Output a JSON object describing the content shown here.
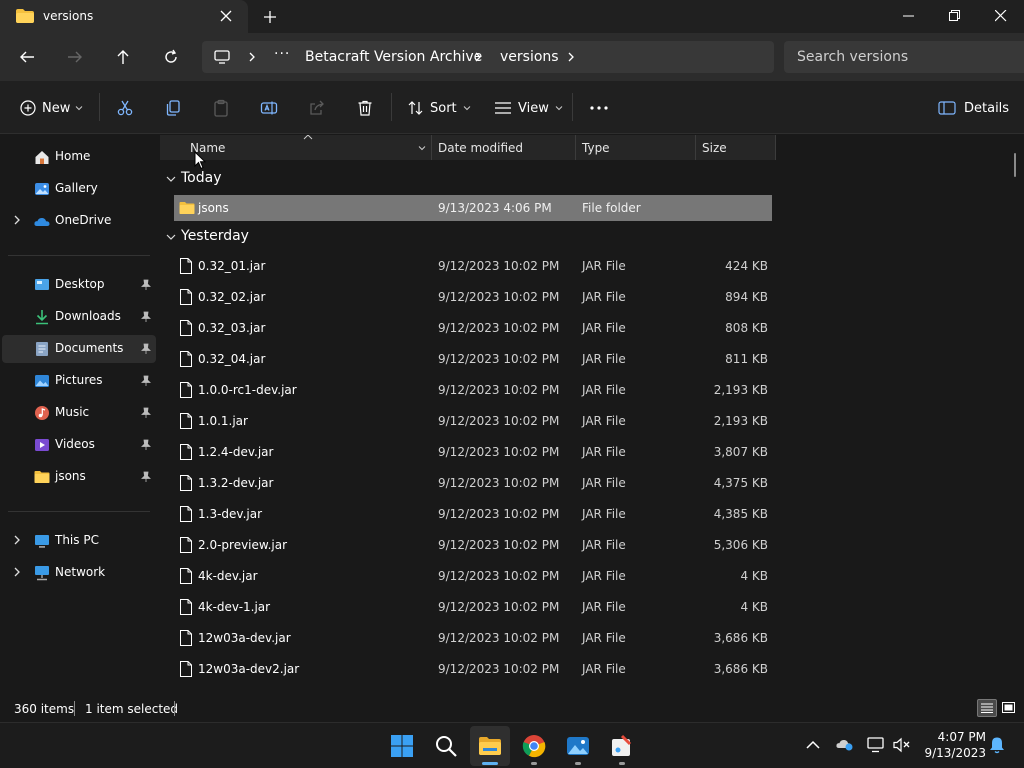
{
  "titlebar": {
    "tab_title": "versions",
    "colors": {
      "folder": "#f4c03e"
    }
  },
  "address": {
    "crumbs": [
      "Betacraft Version Archive",
      "versions"
    ],
    "search_placeholder": "Search versions"
  },
  "commands": {
    "new": "New",
    "sort": "Sort",
    "view": "View",
    "details": "Details"
  },
  "sidebar": {
    "items": [
      {
        "label": "Home",
        "icon": "home-icon"
      },
      {
        "label": "Gallery",
        "icon": "gallery-icon"
      },
      {
        "label": "OneDrive",
        "icon": "onedrive-icon"
      },
      {
        "label": "Desktop",
        "icon": "desktop-icon"
      },
      {
        "label": "Downloads",
        "icon": "download-icon"
      },
      {
        "label": "Documents",
        "icon": "documents-icon"
      },
      {
        "label": "Pictures",
        "icon": "pictures-icon"
      },
      {
        "label": "Music",
        "icon": "music-icon"
      },
      {
        "label": "Videos",
        "icon": "videos-icon"
      },
      {
        "label": "jsons",
        "icon": "folder-icon"
      },
      {
        "label": "This PC",
        "icon": "pc-icon"
      },
      {
        "label": "Network",
        "icon": "network-icon"
      }
    ]
  },
  "columns": {
    "name": "Name",
    "date": "Date modified",
    "type": "Type",
    "size": "Size"
  },
  "groups": {
    "today": "Today",
    "yesterday": "Yesterday"
  },
  "files": [
    {
      "name": "jsons",
      "date": "9/13/2023 4:06 PM",
      "type": "File folder",
      "size": ""
    },
    {
      "name": "0.32_01.jar",
      "date": "9/12/2023 10:02 PM",
      "type": "JAR File",
      "size": "424 KB"
    },
    {
      "name": "0.32_02.jar",
      "date": "9/12/2023 10:02 PM",
      "type": "JAR File",
      "size": "894 KB"
    },
    {
      "name": "0.32_03.jar",
      "date": "9/12/2023 10:02 PM",
      "type": "JAR File",
      "size": "808 KB"
    },
    {
      "name": "0.32_04.jar",
      "date": "9/12/2023 10:02 PM",
      "type": "JAR File",
      "size": "811 KB"
    },
    {
      "name": "1.0.0-rc1-dev.jar",
      "date": "9/12/2023 10:02 PM",
      "type": "JAR File",
      "size": "2,193 KB"
    },
    {
      "name": "1.0.1.jar",
      "date": "9/12/2023 10:02 PM",
      "type": "JAR File",
      "size": "2,193 KB"
    },
    {
      "name": "1.2.4-dev.jar",
      "date": "9/12/2023 10:02 PM",
      "type": "JAR File",
      "size": "3,807 KB"
    },
    {
      "name": "1.3.2-dev.jar",
      "date": "9/12/2023 10:02 PM",
      "type": "JAR File",
      "size": "4,375 KB"
    },
    {
      "name": "1.3-dev.jar",
      "date": "9/12/2023 10:02 PM",
      "type": "JAR File",
      "size": "4,385 KB"
    },
    {
      "name": "2.0-preview.jar",
      "date": "9/12/2023 10:02 PM",
      "type": "JAR File",
      "size": "5,306 KB"
    },
    {
      "name": "4k-dev.jar",
      "date": "9/12/2023 10:02 PM",
      "type": "JAR File",
      "size": "4 KB"
    },
    {
      "name": "4k-dev-1.jar",
      "date": "9/12/2023 10:02 PM",
      "type": "JAR File",
      "size": "4 KB"
    },
    {
      "name": "12w03a-dev.jar",
      "date": "9/12/2023 10:02 PM",
      "type": "JAR File",
      "size": "3,686 KB"
    },
    {
      "name": "12w03a-dev2.jar",
      "date": "9/12/2023 10:02 PM",
      "type": "JAR File",
      "size": "3,686 KB"
    }
  ],
  "status": {
    "count": "360 items",
    "selected": "1 item selected"
  },
  "clock": {
    "time": "4:07 PM",
    "date": "9/13/2023"
  }
}
